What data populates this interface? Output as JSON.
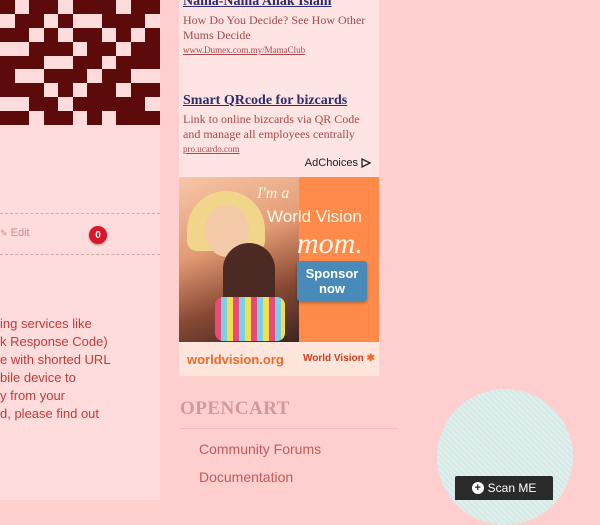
{
  "left_panel": {
    "edit_label": "Edit",
    "comment_count": "0",
    "description_lines": [
      "ing services like",
      "k Response Code)",
      "e with shorted URL",
      "bile device to",
      "y from your",
      "d, please find out"
    ]
  },
  "ads": [
    {
      "title": "Nama-Nama Anak Islam",
      "text": "How Do You Decide? See How Other Mums Decide",
      "url": "www.Dumex.com.my/MamaClub"
    },
    {
      "title": "Smart QRcode for bizcards",
      "text": "Link to online bizcards via QR Code and manage all employees centrally",
      "url": "pro.ucardo.com"
    }
  ],
  "adchoices_label": "AdChoices",
  "banner": {
    "tagline_top": "I'm a",
    "tagline_brand": "World Vision",
    "tagline_mom": "mom.",
    "button_label": "Sponsor now",
    "site": "worldvision.org",
    "logo_text": "World Vision"
  },
  "opencart": {
    "heading": "OPENCART",
    "links": [
      "Community Forums",
      "Documentation"
    ]
  },
  "scan_button": {
    "label": "Scan ME",
    "icon": "plus-circle-icon"
  },
  "colors": {
    "page_bg": "#ffcfcf",
    "badge": "#d8182a",
    "link_dark": "#2d2d6e",
    "banner_orange": "#ff8a4a",
    "sponsor_blue": "#4a8ab8"
  }
}
